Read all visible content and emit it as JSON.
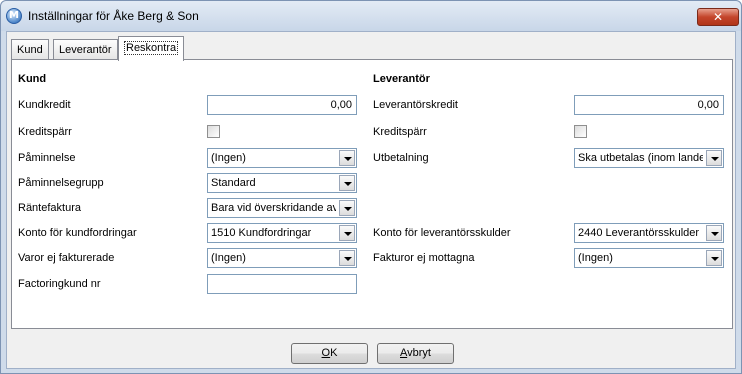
{
  "window": {
    "title": "Inställningar för Åke Berg & Son",
    "app_icon": "M",
    "close_glyph": "✕"
  },
  "tabs": [
    {
      "label": "Kund"
    },
    {
      "label": "Leverantör"
    },
    {
      "label": "Reskontra",
      "active": true
    }
  ],
  "kund": {
    "heading": "Kund",
    "kredit_label": "Kundkredit",
    "kredit_value": "0,00",
    "kreditsparr_label": "Kreditspärr",
    "kreditsparr_checked": false,
    "paminnelse_label": "Påminnelse",
    "paminnelse_value": "(Ingen)",
    "paminnelsegrupp_label": "Påminnelsegrupp",
    "paminnelsegrupp_value": "Standard",
    "rantefaktura_label": "Räntefaktura",
    "rantefaktura_value": "Bara vid överskridande av",
    "konto_label": "Konto för kundfordringar",
    "konto_value": "1510 Kundfordringar",
    "varor_label": "Varor ej fakturerade",
    "varor_value": "(Ingen)",
    "factoring_label": "Factoringkund nr",
    "factoring_value": ""
  },
  "leverantor": {
    "heading": "Leverantör",
    "kredit_label": "Leverantörskredit",
    "kredit_value": "0,00",
    "kreditsparr_label": "Kreditspärr",
    "kreditsparr_checked": false,
    "utbetalning_label": "Utbetalning",
    "utbetalning_value": "Ska utbetalas (inom landet",
    "konto_label": "Konto för leverantörsskulder",
    "konto_value": "2440 Leverantörsskulder",
    "fakturor_label": "Fakturor ej mottagna",
    "fakturor_value": "(Ingen)"
  },
  "buttons": {
    "ok_accel": "O",
    "ok_rest": "K",
    "cancel_accel": "A",
    "cancel_rest": "vbryt"
  }
}
